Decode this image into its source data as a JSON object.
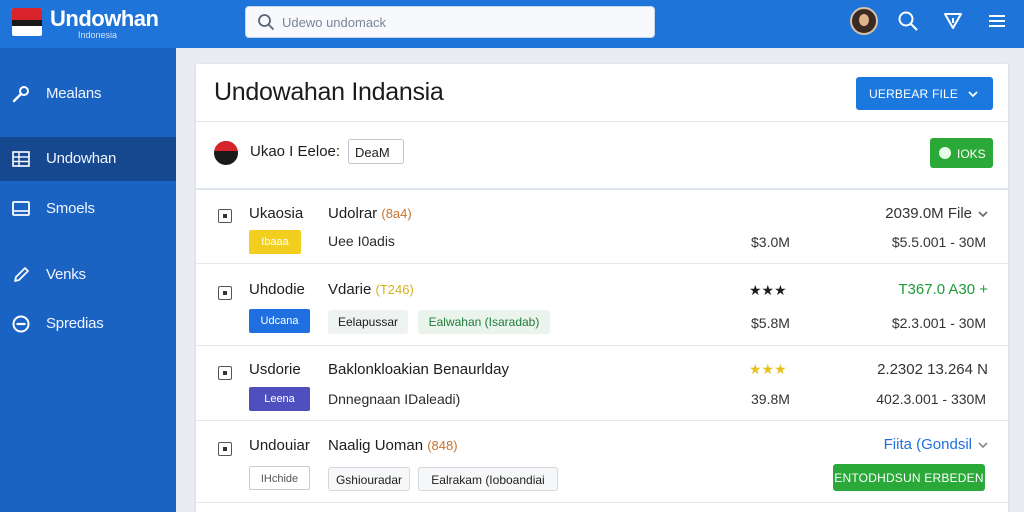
{
  "app": {
    "title": "Undowhan",
    "subtitle": "Indonesia"
  },
  "search": {
    "placeholder": "Udewo undomack"
  },
  "header_icons": [
    "avatar",
    "search-icon",
    "filter-icon",
    "menu-icon"
  ],
  "sidebar": {
    "items": [
      {
        "label": "Mealans",
        "icon": "wrench-icon",
        "active": false
      },
      {
        "label": "Undowhan",
        "icon": "grid-icon",
        "active": true
      },
      {
        "label": "Smoels",
        "icon": "monitor-icon",
        "active": false
      },
      {
        "label": "Venks",
        "icon": "pencil-icon",
        "active": false
      },
      {
        "label": "Spredias",
        "icon": "minus-circle-icon",
        "active": false
      }
    ]
  },
  "main": {
    "title": "Undowahan Indansia",
    "primary_button": "UERBEAR FILE",
    "filter": {
      "label": "Ukao I Eeloe:",
      "chip": "DeaM",
      "button": "IOKS"
    }
  },
  "rows": [
    {
      "name": "Ukaosia",
      "sub": "Udolrar",
      "code": "(8a4)",
      "code_color": "#c6742f",
      "tag": "Ibaaa",
      "tag_color": "#f2cf1f",
      "tag_text_color": "#ffffff",
      "detail": "Uee I0adis",
      "stars": "",
      "price": "$3.0M",
      "right_top": "2039.0M File",
      "right_top_color": "#333333",
      "right_bottom": "$5.5.001 - 30M"
    },
    {
      "name": "Uhdodie",
      "sub": "Vdarie",
      "code": "(T246)",
      "code_color": "#d4b21b",
      "tag": "Udcana",
      "tag_color": "#1f6fe0",
      "tag_text_color": "#ffffff",
      "chips": [
        "Eelapussar",
        "Ealwahan (Isaradab)"
      ],
      "stars": "★★★",
      "stars_color": "#1d1d1d",
      "price": "$5.8M",
      "right_top": "T367.0 A30 +",
      "right_top_color": "#1f9a3a",
      "right_bottom": "$2.3.001 - 30M"
    },
    {
      "name": "Usdorie",
      "sub": "Baklonkloakian Benaurlday",
      "code": "",
      "tag": "Leena",
      "tag_color": "#4f4fbf",
      "tag_text_color": "#ffffff",
      "detail": "Dnnegnaan IDaleadi)",
      "stars": "★★★",
      "stars_color": "#e7c21f",
      "price": "39.8M",
      "right_top": "2.2302 13.264 N",
      "right_top_color": "#1f9a3a",
      "right_bottom": "402.3.001 - 330M"
    },
    {
      "name": "Undouiar",
      "sub": "Naalig Uoman",
      "code": "(848)",
      "code_color": "#c6742f",
      "tag": "IHchide",
      "tag_color": "#ffffff",
      "tag_text_color": "#555555",
      "chips": [
        "Gshiouradar",
        "Ealrakam (Ioboandiai"
      ],
      "stars": "",
      "price": "",
      "right_top": "Fiita (Gondsil",
      "right_top_color": "#1f6fe0",
      "right_button": "ENTODHDSUN ERBEDEN"
    }
  ]
}
